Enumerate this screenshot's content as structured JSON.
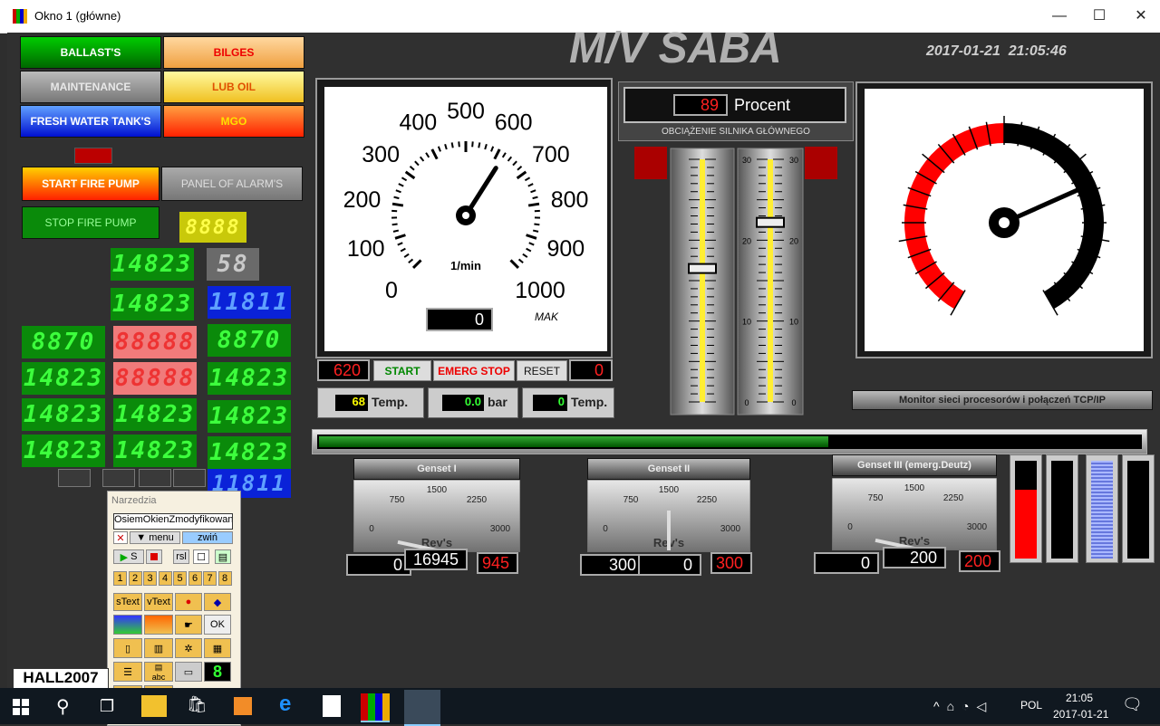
{
  "window": {
    "title": "Okno 1 (główne)",
    "minimize": "—",
    "maximize": "☐",
    "close": "✕"
  },
  "header": {
    "ship_title": "M/V SABA",
    "datetime": "2017-01-21  21:05:46"
  },
  "nav_buttons": [
    {
      "label": "BALLAST'S",
      "color": "#00b000"
    },
    {
      "label": "BILGES",
      "color": "#f8c070"
    },
    {
      "label": "MAINTENANCE",
      "color": "#909090"
    },
    {
      "label": "LUB OIL",
      "color": "#fff080"
    },
    {
      "label": "FRESH WATER TANK'S",
      "color": "#2040ff"
    },
    {
      "label": "MGO",
      "color": "#ff8000"
    }
  ],
  "fire": {
    "start": "START FIRE PUMP",
    "stop": "STOP FIRE PUMP",
    "alarms": "PANEL OF ALARM'S"
  },
  "segments": {
    "yellow": "8888",
    "gray": "58",
    "green1": "14823",
    "green2": "14823",
    "blue1": "11811",
    "blue2": "11811",
    "row_a": [
      "8870",
      "88888",
      "8870"
    ],
    "row_b": [
      "14823",
      "88888",
      "14823"
    ],
    "row_c": [
      "14823",
      "14823",
      "14823"
    ],
    "row_d": [
      "14823",
      "14823",
      "14823"
    ]
  },
  "rpm_gauge": {
    "ticks": [
      "0",
      "100",
      "200",
      "300",
      "400",
      "500",
      "600",
      "700",
      "800",
      "900",
      "1000"
    ],
    "unit": "1/min",
    "max_label": "MAK",
    "value": 620,
    "display": "0"
  },
  "engine_controls": {
    "left_value": "620",
    "start": "START",
    "emerg": "EMERG STOP",
    "reset": "RESET",
    "right_value": "0"
  },
  "temps": [
    {
      "value": "68",
      "unit": "Temp."
    },
    {
      "value": "0.0",
      "unit": "bar"
    },
    {
      "value": "0",
      "unit": "Temp."
    }
  ],
  "load": {
    "value": "89",
    "unit": "Procent",
    "caption": "OBCIĄŻENIE SILNIKA GŁÓWNEGO"
  },
  "sliders": {
    "scale": [
      "30",
      "20",
      "10",
      "0"
    ],
    "left_level": 0.55,
    "right_level": 0.74
  },
  "big_gauge": {
    "needle_fraction": 0.72
  },
  "monitor_btn": "Monitor sieci procesorów i połączeń TCP/IP",
  "progress": {
    "fraction": 0.62
  },
  "gensets": [
    {
      "title": "Genset I",
      "scale": [
        "0",
        "750",
        "1500",
        "2250",
        "3000"
      ],
      "label": "Rev's",
      "left": "0",
      "mid": "16945",
      "right": "945"
    },
    {
      "title": "Genset II",
      "scale": [
        "0",
        "750",
        "1500",
        "2250",
        "3000"
      ],
      "label": "Rev's",
      "left": "300",
      "mid": "0",
      "right": "300"
    },
    {
      "title": "Genset III (emerg.Deutz)",
      "scale": [
        "0",
        "750",
        "1500",
        "2250",
        "3000"
      ],
      "label": "Rev's",
      "left": "0",
      "mid": "200",
      "right": "200"
    }
  ],
  "bars": [
    0.7,
    0,
    1.0,
    0
  ],
  "tools": {
    "title": "Narzedzia",
    "input": "OsiemOkienZmodyfikowan",
    "menu": "menu",
    "zwin": "zwiń",
    "s": "S",
    "rsl": "rsl",
    "numbers": [
      "1",
      "2",
      "3",
      "4",
      "5",
      "6",
      "7",
      "8"
    ],
    "stext": "sText",
    "vtext": "vText",
    "ok": "OK",
    "abc": "abc"
  },
  "hall": "HALL2007",
  "taskbar": {
    "lang": "POL",
    "time": "21:05",
    "date": "2017-01-21"
  }
}
